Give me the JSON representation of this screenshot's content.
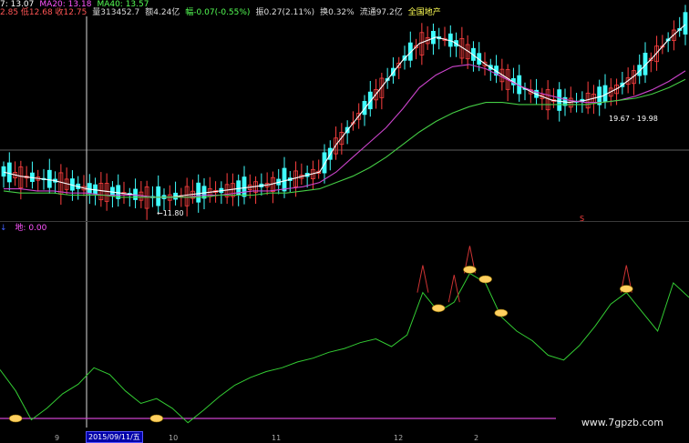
{
  "header": {
    "row1": [
      {
        "text": "7: 13.07",
        "color": "#ffffff"
      },
      {
        "text": "MA20: 13.18",
        "color": "#ff55ff"
      },
      {
        "text": "MA40: 13.57",
        "color": "#55ff55"
      }
    ],
    "row2": [
      {
        "text": "2.85 低12.68 收12.75",
        "color": "#ff5555"
      },
      {
        "text": "量313452.7",
        "color": "#dddddd"
      },
      {
        "text": "额4.24亿",
        "color": "#dddddd"
      },
      {
        "text": "幅-0.07(-0.55%)",
        "color": "#55ff55"
      },
      {
        "text": "振0.27(2.11%)",
        "color": "#dddddd"
      },
      {
        "text": "换0.32%",
        "color": "#dddddd"
      },
      {
        "text": "流通97.2亿",
        "color": "#dddddd"
      },
      {
        "text": "全国地产",
        "color": "#ffff55"
      }
    ],
    "sub_indicator": "地: 0.00",
    "sub_color": "#ff55ff"
  },
  "labels": {
    "low_price": "11.80",
    "range_price": "19.67 - 19.98",
    "s_marker": "S",
    "date_cursor": "2015/09/11/五",
    "watermark": "www.7gpzb.com",
    "x_ticks": [
      "9",
      "10",
      "11",
      "12",
      "2"
    ]
  },
  "colors": {
    "up": "#ff4040",
    "down": "#40ffff",
    "ma_white": "#ffffff",
    "ma20": "#cc44cc",
    "ma40": "#44cc44",
    "indicator": "#33cc33",
    "peak": "#cc3333",
    "flat_line": "#cc44cc",
    "marker": "#ffd060"
  },
  "chart_data": [
    {
      "type": "candlestick",
      "title": "",
      "series": [
        {
          "name": "7",
          "values": [
            13.2,
            13.0,
            12.9,
            12.8,
            12.6,
            12.4,
            12.3,
            12.2,
            12.1,
            12.0,
            12.0,
            12.1,
            12.2,
            12.3,
            12.4,
            12.5,
            12.6,
            12.8,
            13.0,
            13.2,
            14.5,
            15.5,
            16.5,
            17.5,
            18.5,
            19.3,
            19.6,
            19.4,
            18.9,
            18.3,
            17.8,
            17.3,
            16.9,
            16.6,
            16.5,
            16.6,
            16.8,
            17.2,
            17.8,
            18.6,
            19.5,
            20.2
          ]
        },
        {
          "name": "MA20",
          "values": [
            12.4,
            12.4,
            12.3,
            12.3,
            12.2,
            12.2,
            12.1,
            12.1,
            12.1,
            12.0,
            12.0,
            12.0,
            12.1,
            12.1,
            12.2,
            12.3,
            12.3,
            12.4,
            12.5,
            12.7,
            13.2,
            13.9,
            14.6,
            15.3,
            16.2,
            17.2,
            17.8,
            18.2,
            18.3,
            18.1,
            17.7,
            17.3,
            17.0,
            16.8,
            16.6,
            16.5,
            16.5,
            16.6,
            16.8,
            17.1,
            17.5,
            18.0
          ]
        },
        {
          "name": "MA40",
          "values": [
            12.3,
            12.2,
            12.2,
            12.2,
            12.1,
            12.1,
            12.1,
            12.0,
            12.0,
            12.0,
            12.0,
            12.0,
            12.0,
            12.1,
            12.1,
            12.1,
            12.2,
            12.2,
            12.3,
            12.4,
            12.7,
            13.0,
            13.4,
            13.9,
            14.5,
            15.1,
            15.6,
            16.0,
            16.3,
            16.5,
            16.5,
            16.4,
            16.4,
            16.4,
            16.4,
            16.4,
            16.5,
            16.6,
            16.7,
            16.9,
            17.2,
            17.6
          ]
        }
      ],
      "candles_count": 120,
      "ylim": [
        11.0,
        20.5
      ]
    },
    {
      "type": "line",
      "title": "",
      "series": [
        {
          "name": "地",
          "values": [
            60,
            38,
            8,
            20,
            35,
            45,
            62,
            55,
            38,
            25,
            30,
            20,
            5,
            18,
            32,
            44,
            52,
            58,
            62,
            68,
            72,
            78,
            82,
            88,
            92,
            84,
            96,
            140,
            120,
            130,
            160,
            150,
            115,
            100,
            90,
            75,
            70,
            85,
            105,
            128,
            140,
            120,
            100,
            150,
            135
          ]
        }
      ],
      "ylim": [
        0,
        200
      ]
    }
  ]
}
